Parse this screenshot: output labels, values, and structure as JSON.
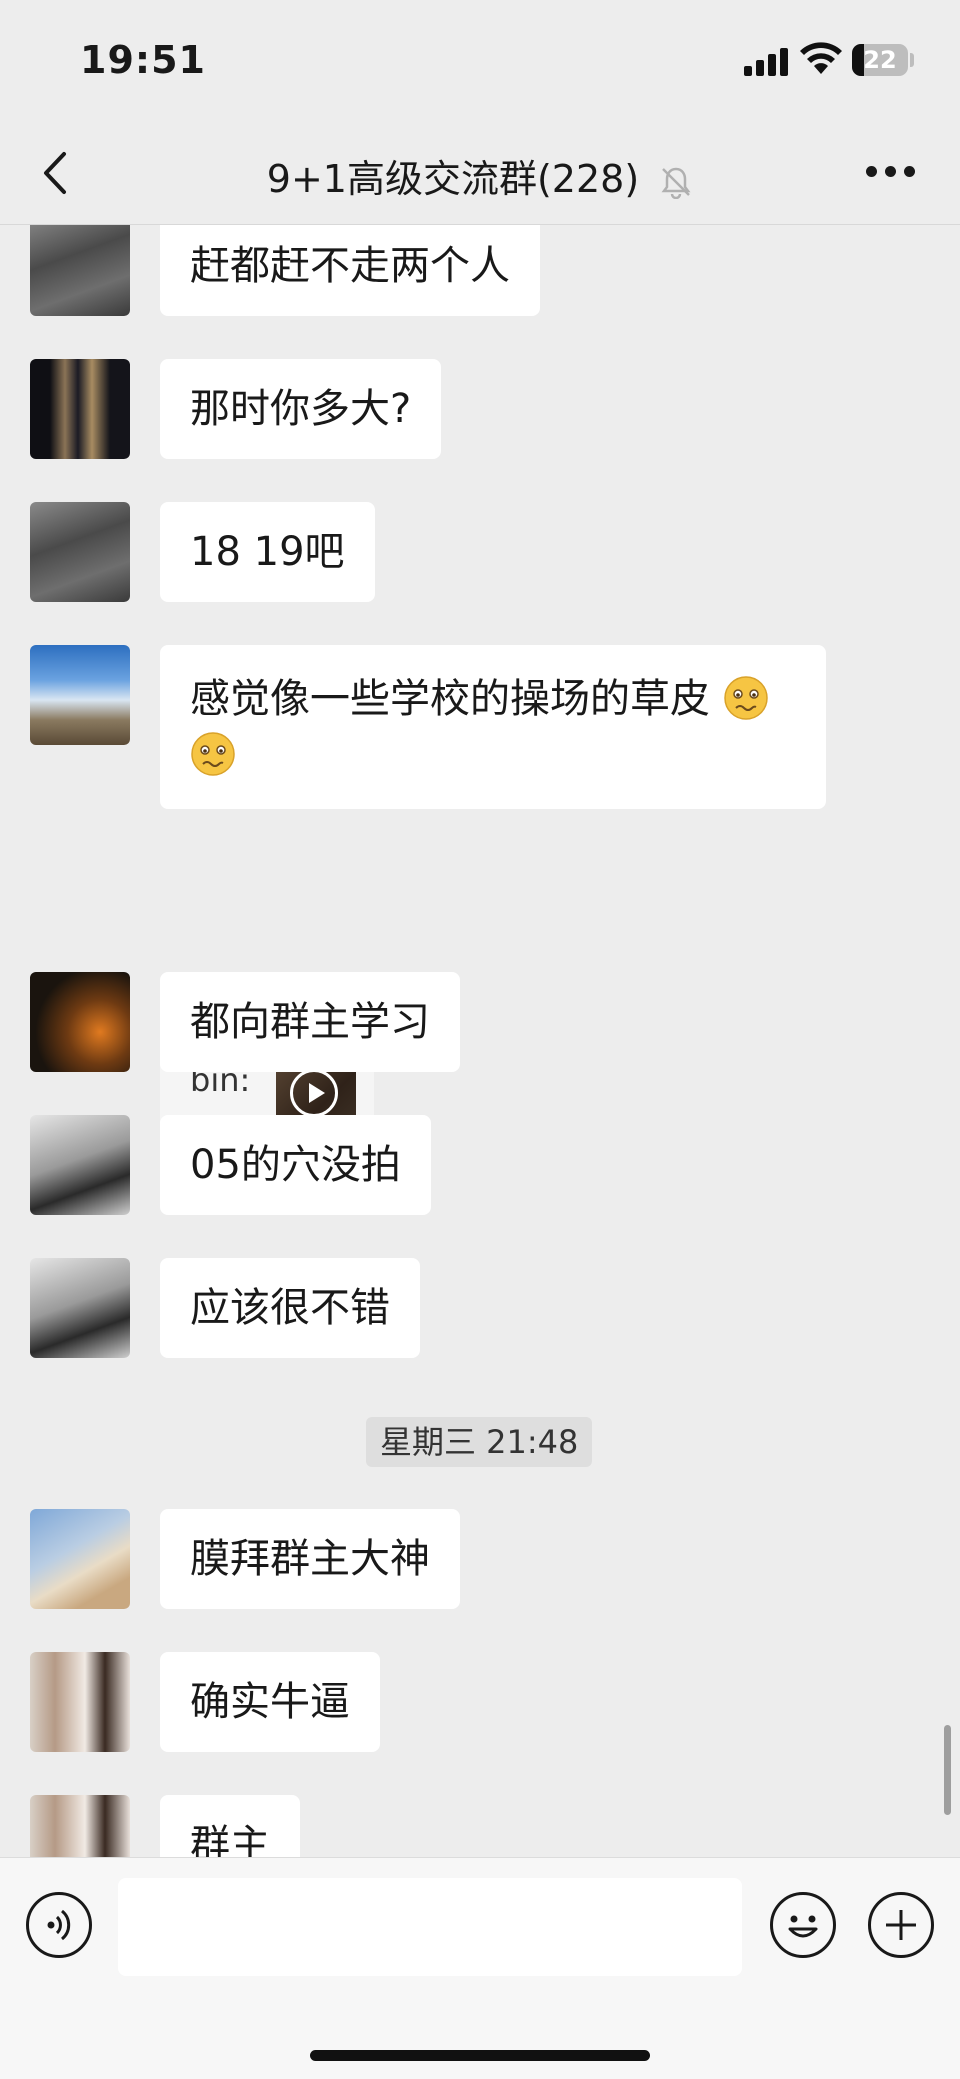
{
  "status_bar": {
    "time": "19:51",
    "battery": "22"
  },
  "header": {
    "title": "9+1高级交流群(228)"
  },
  "messages": [
    {
      "text": "赶都赶不走两个人"
    },
    {
      "text": "那时你多大?"
    },
    {
      "text": "18  19吧"
    },
    {
      "text": "感觉像一些学校的操场的草皮"
    },
    {
      "text": "都向群主学习"
    },
    {
      "text": "05的穴没拍"
    },
    {
      "text": "应该很不错"
    },
    {
      "text": "膜拜群主大神"
    },
    {
      "text": "确实牛逼"
    },
    {
      "text": "群主"
    }
  ],
  "quote": {
    "sender": "bin:"
  },
  "timestamp": "星期三 21:48",
  "colors": {
    "background": "#ededed",
    "bubble": "#ffffff",
    "text": "#191919"
  },
  "icons": [
    "back-chevron-icon",
    "mute-bell-icon",
    "more-icon",
    "voice-icon",
    "emoji-icon",
    "plus-icon",
    "play-icon"
  ]
}
